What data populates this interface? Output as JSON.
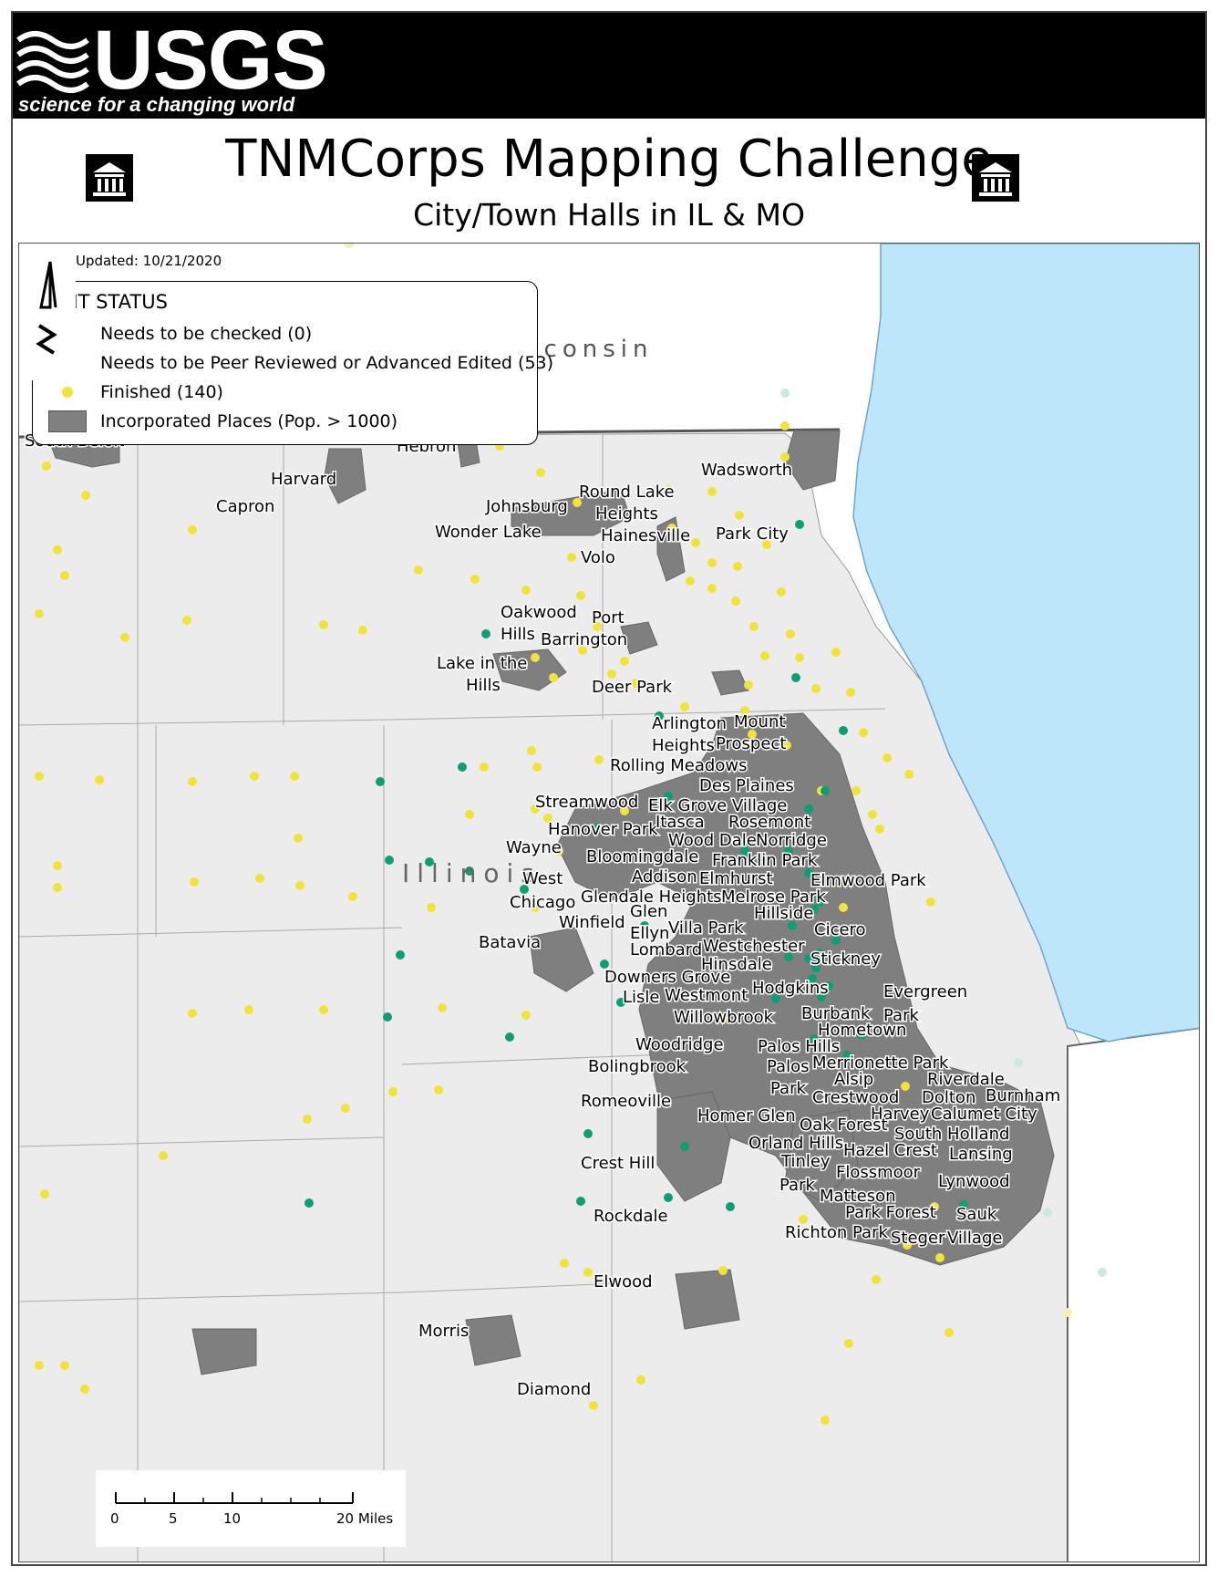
{
  "header": {
    "logo_text": "USGS",
    "logo_tagline": "science for a changing world",
    "title": "TNMCorps Mapping Challenge",
    "subtitle": "City/Town Halls in IL & MO"
  },
  "map": {
    "last_updated": "Last Updated: 10/21/2020",
    "region_labels": [
      {
        "text": "sconsin"
      },
      {
        "text": "Illinois"
      }
    ],
    "colors": {
      "needs_checked": "#e66a00",
      "peer_review": "#0d9e74",
      "finished": "#f2e33a",
      "incorporated": "#7f7f7f",
      "lake": "#bee6fb",
      "land": "#ececec"
    }
  },
  "legend": {
    "title": "EDIT STATUS",
    "items": [
      {
        "label": "Needs to be checked (0)",
        "type": "dot",
        "color": "#e66a00"
      },
      {
        "label": "Needs to be Peer Reviewed or Advanced Edited (53)",
        "type": "dot",
        "color": "#0d9e74"
      },
      {
        "label": "Finished (140)",
        "type": "dot",
        "color": "#f2e33a"
      },
      {
        "label": "Incorporated Places (Pop. > 1000)",
        "type": "swatch",
        "color": "#808080"
      }
    ]
  },
  "scalebar": {
    "labels": [
      "0",
      "5",
      "10",
      "20 Miles"
    ]
  },
  "places": [
    "South Beloit",
    "Hebron",
    "Harvard",
    "Capron",
    "Johnsburg",
    "Wonder Lake",
    "Round Lake",
    "Heights",
    "Hainesville",
    "Volo",
    "Wadsworth",
    "Park City",
    "Oakwood",
    "Hills",
    "Port",
    "Barrington",
    "Lake in the",
    "Hills",
    "Deer Park",
    "Arlington",
    "Heights",
    "Mount",
    "Prospect",
    "Rolling Meadows",
    "Des Plaines",
    "Streamwood",
    "Elk Grove Village",
    "Hanover Park",
    "Itasca",
    "Rosemont",
    "Wood Dale",
    "Norridge",
    "Wayne",
    "Bloomingdale",
    "Franklin Park",
    "Addison",
    "Elmhurst",
    "Elmwood Park",
    "West",
    "Chicago",
    "Glendale Heights",
    "Melrose Park",
    "Glen",
    "Hillside",
    "Winfield",
    "Ellyn",
    "Villa Park",
    "Cicero",
    "Batavia",
    "Lombard",
    "Westchester",
    "Hinsdale",
    "Stickney",
    "Downers Grove",
    "Hodgkins",
    "Lisle",
    "Westmont",
    "Evergreen",
    "Willowbrook",
    "Burbank",
    "Park",
    "Hometown",
    "Woodridge",
    "Palos Hills",
    "Bolingbrook",
    "Palos",
    "Merrionette Park",
    "Alsip",
    "Riverdale",
    "Park",
    "Crestwood",
    "Dolton",
    "Burnham",
    "Romeoville",
    "Harvey",
    "Calumet City",
    "Homer Glen",
    "Oak Forest",
    "South Holland",
    "Orland Hills",
    "Hazel Crest",
    "Lansing",
    "Crest Hill",
    "Tinley",
    "Flossmoor",
    "Park",
    "Lynwood",
    "Matteson",
    "Park Forest",
    "Sauk",
    "Rockdale",
    "Richton Park",
    "Steger",
    "Village",
    "Elwood",
    "Morris",
    "Diamond"
  ]
}
